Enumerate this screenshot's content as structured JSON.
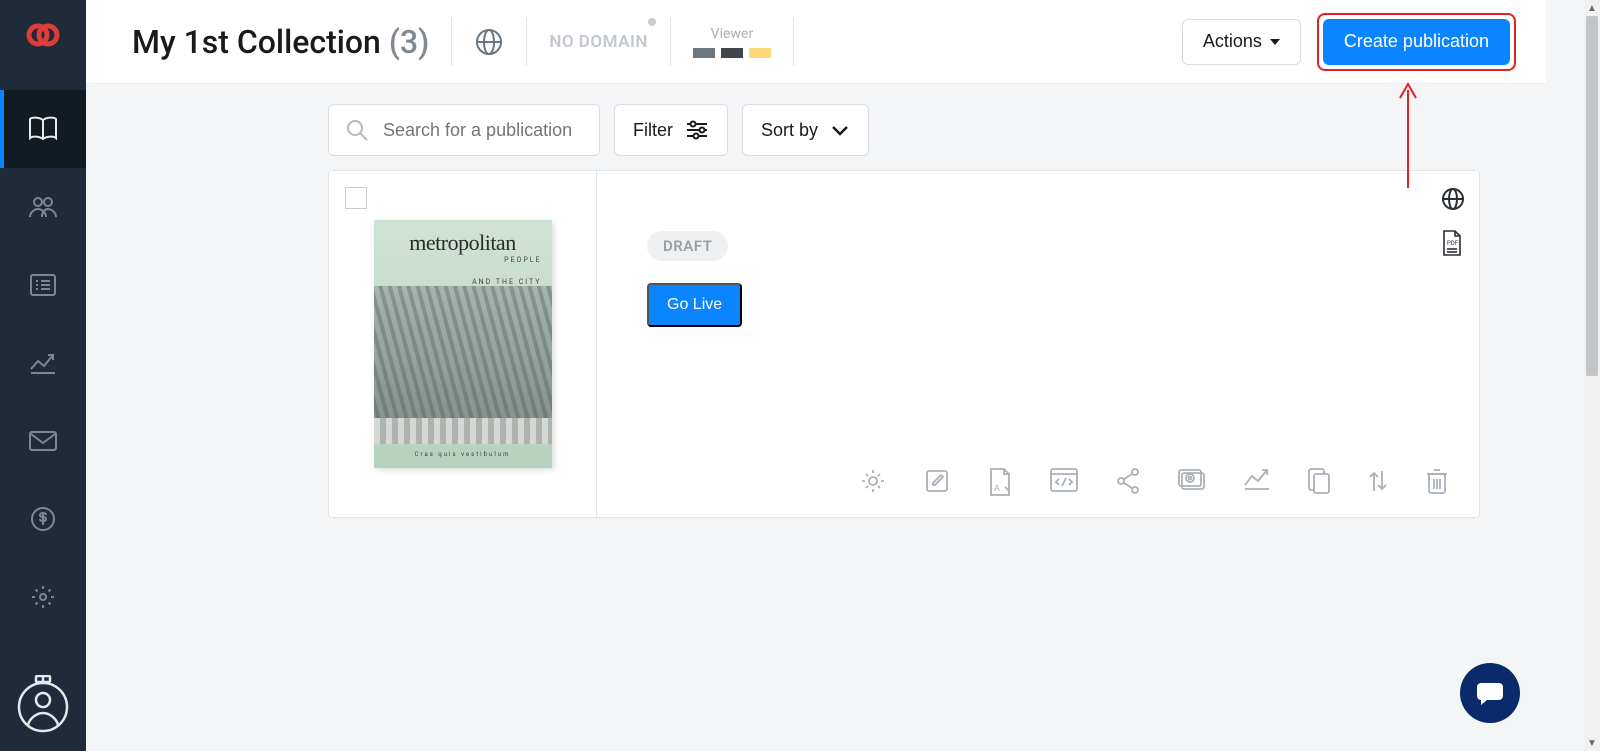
{
  "header": {
    "title": "My 1st Collection",
    "count": "(3)",
    "no_domain": "NO DOMAIN",
    "viewer_label": "Viewer",
    "actions_label": "Actions",
    "create_label": "Create publication"
  },
  "toolbar": {
    "search_placeholder": "Search for a publication",
    "filter_label": "Filter",
    "sort_label": "Sort by"
  },
  "publication": {
    "status": "DRAFT",
    "go_live_label": "Go Live",
    "cover": {
      "title": "metropolitan",
      "sub1": "PEOPLE",
      "sub2": "AND THE CITY",
      "footer": "Cras quis vestibulum"
    }
  },
  "colors": {
    "swatch_a": "#707880",
    "swatch_b": "#3e464e",
    "swatch_c": "#ffd878"
  }
}
